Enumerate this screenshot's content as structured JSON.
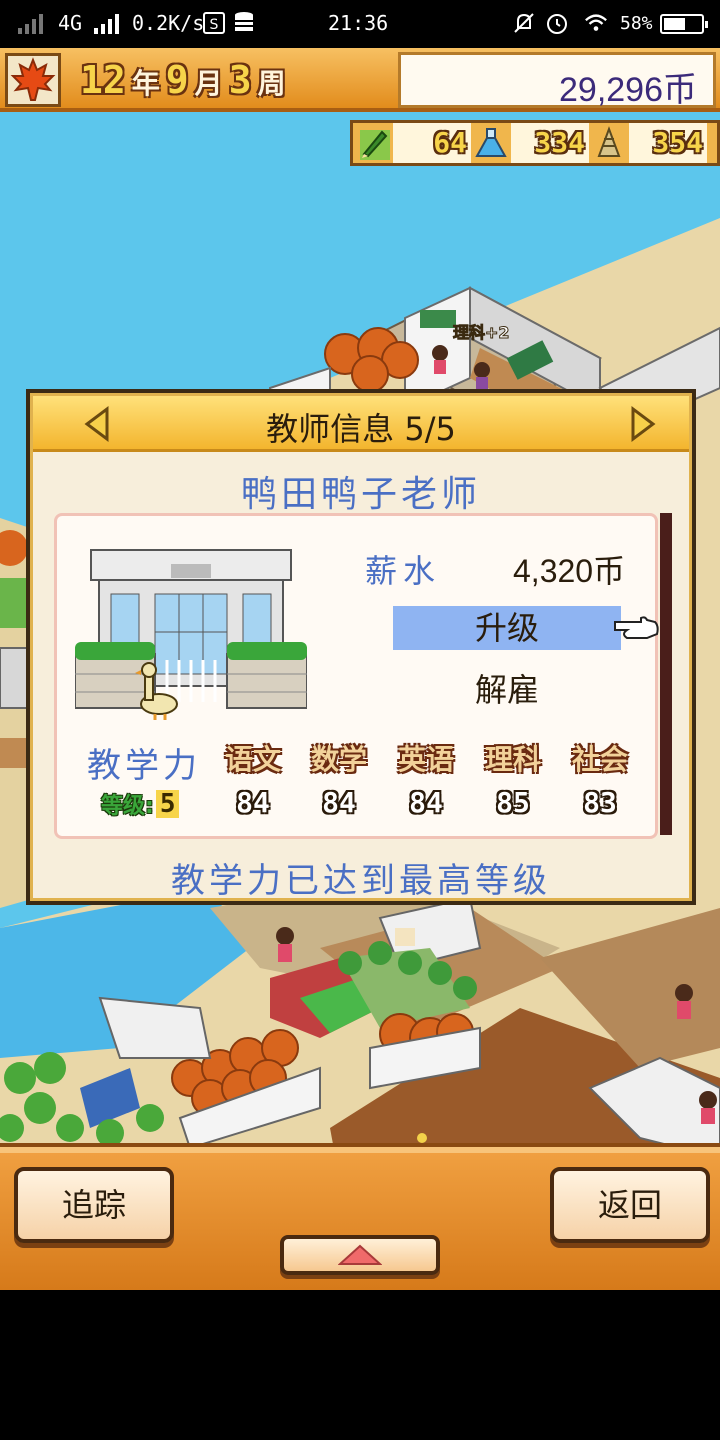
{
  "status_bar": {
    "network": "4G",
    "speed": "0.2K/s",
    "time": "21:36",
    "battery": "58%",
    "battery_level": 0.58
  },
  "hud": {
    "year": "12",
    "year_unit": "年",
    "month": "9",
    "month_unit": "月",
    "week": "3",
    "week_unit": "周",
    "money": "29,296币",
    "resources": [
      {
        "icon": "pencil-icon",
        "value": "64"
      },
      {
        "icon": "flask-icon",
        "value": "334"
      },
      {
        "icon": "tower-icon",
        "value": "354"
      }
    ]
  },
  "game_world": {
    "float_text": "理科+2"
  },
  "dialog": {
    "title": "教师信息 5/5",
    "teacher_name": "鸭田鸭子老师",
    "salary_label": "薪水",
    "salary_value": "4,320币",
    "upgrade_label": "升级",
    "fire_label": "解雇",
    "teaching_label": "教学力",
    "level_label": "等级:",
    "level_value": "5",
    "subjects": [
      {
        "name": "语文",
        "score": "84"
      },
      {
        "name": "数学",
        "score": "84"
      },
      {
        "name": "英语",
        "score": "84"
      },
      {
        "name": "理科",
        "score": "85"
      },
      {
        "name": "社会",
        "score": "83"
      }
    ],
    "max_message": "教学力已达到最高等级"
  },
  "bottom_bar": {
    "track_label": "追踪",
    "back_label": "返回"
  }
}
